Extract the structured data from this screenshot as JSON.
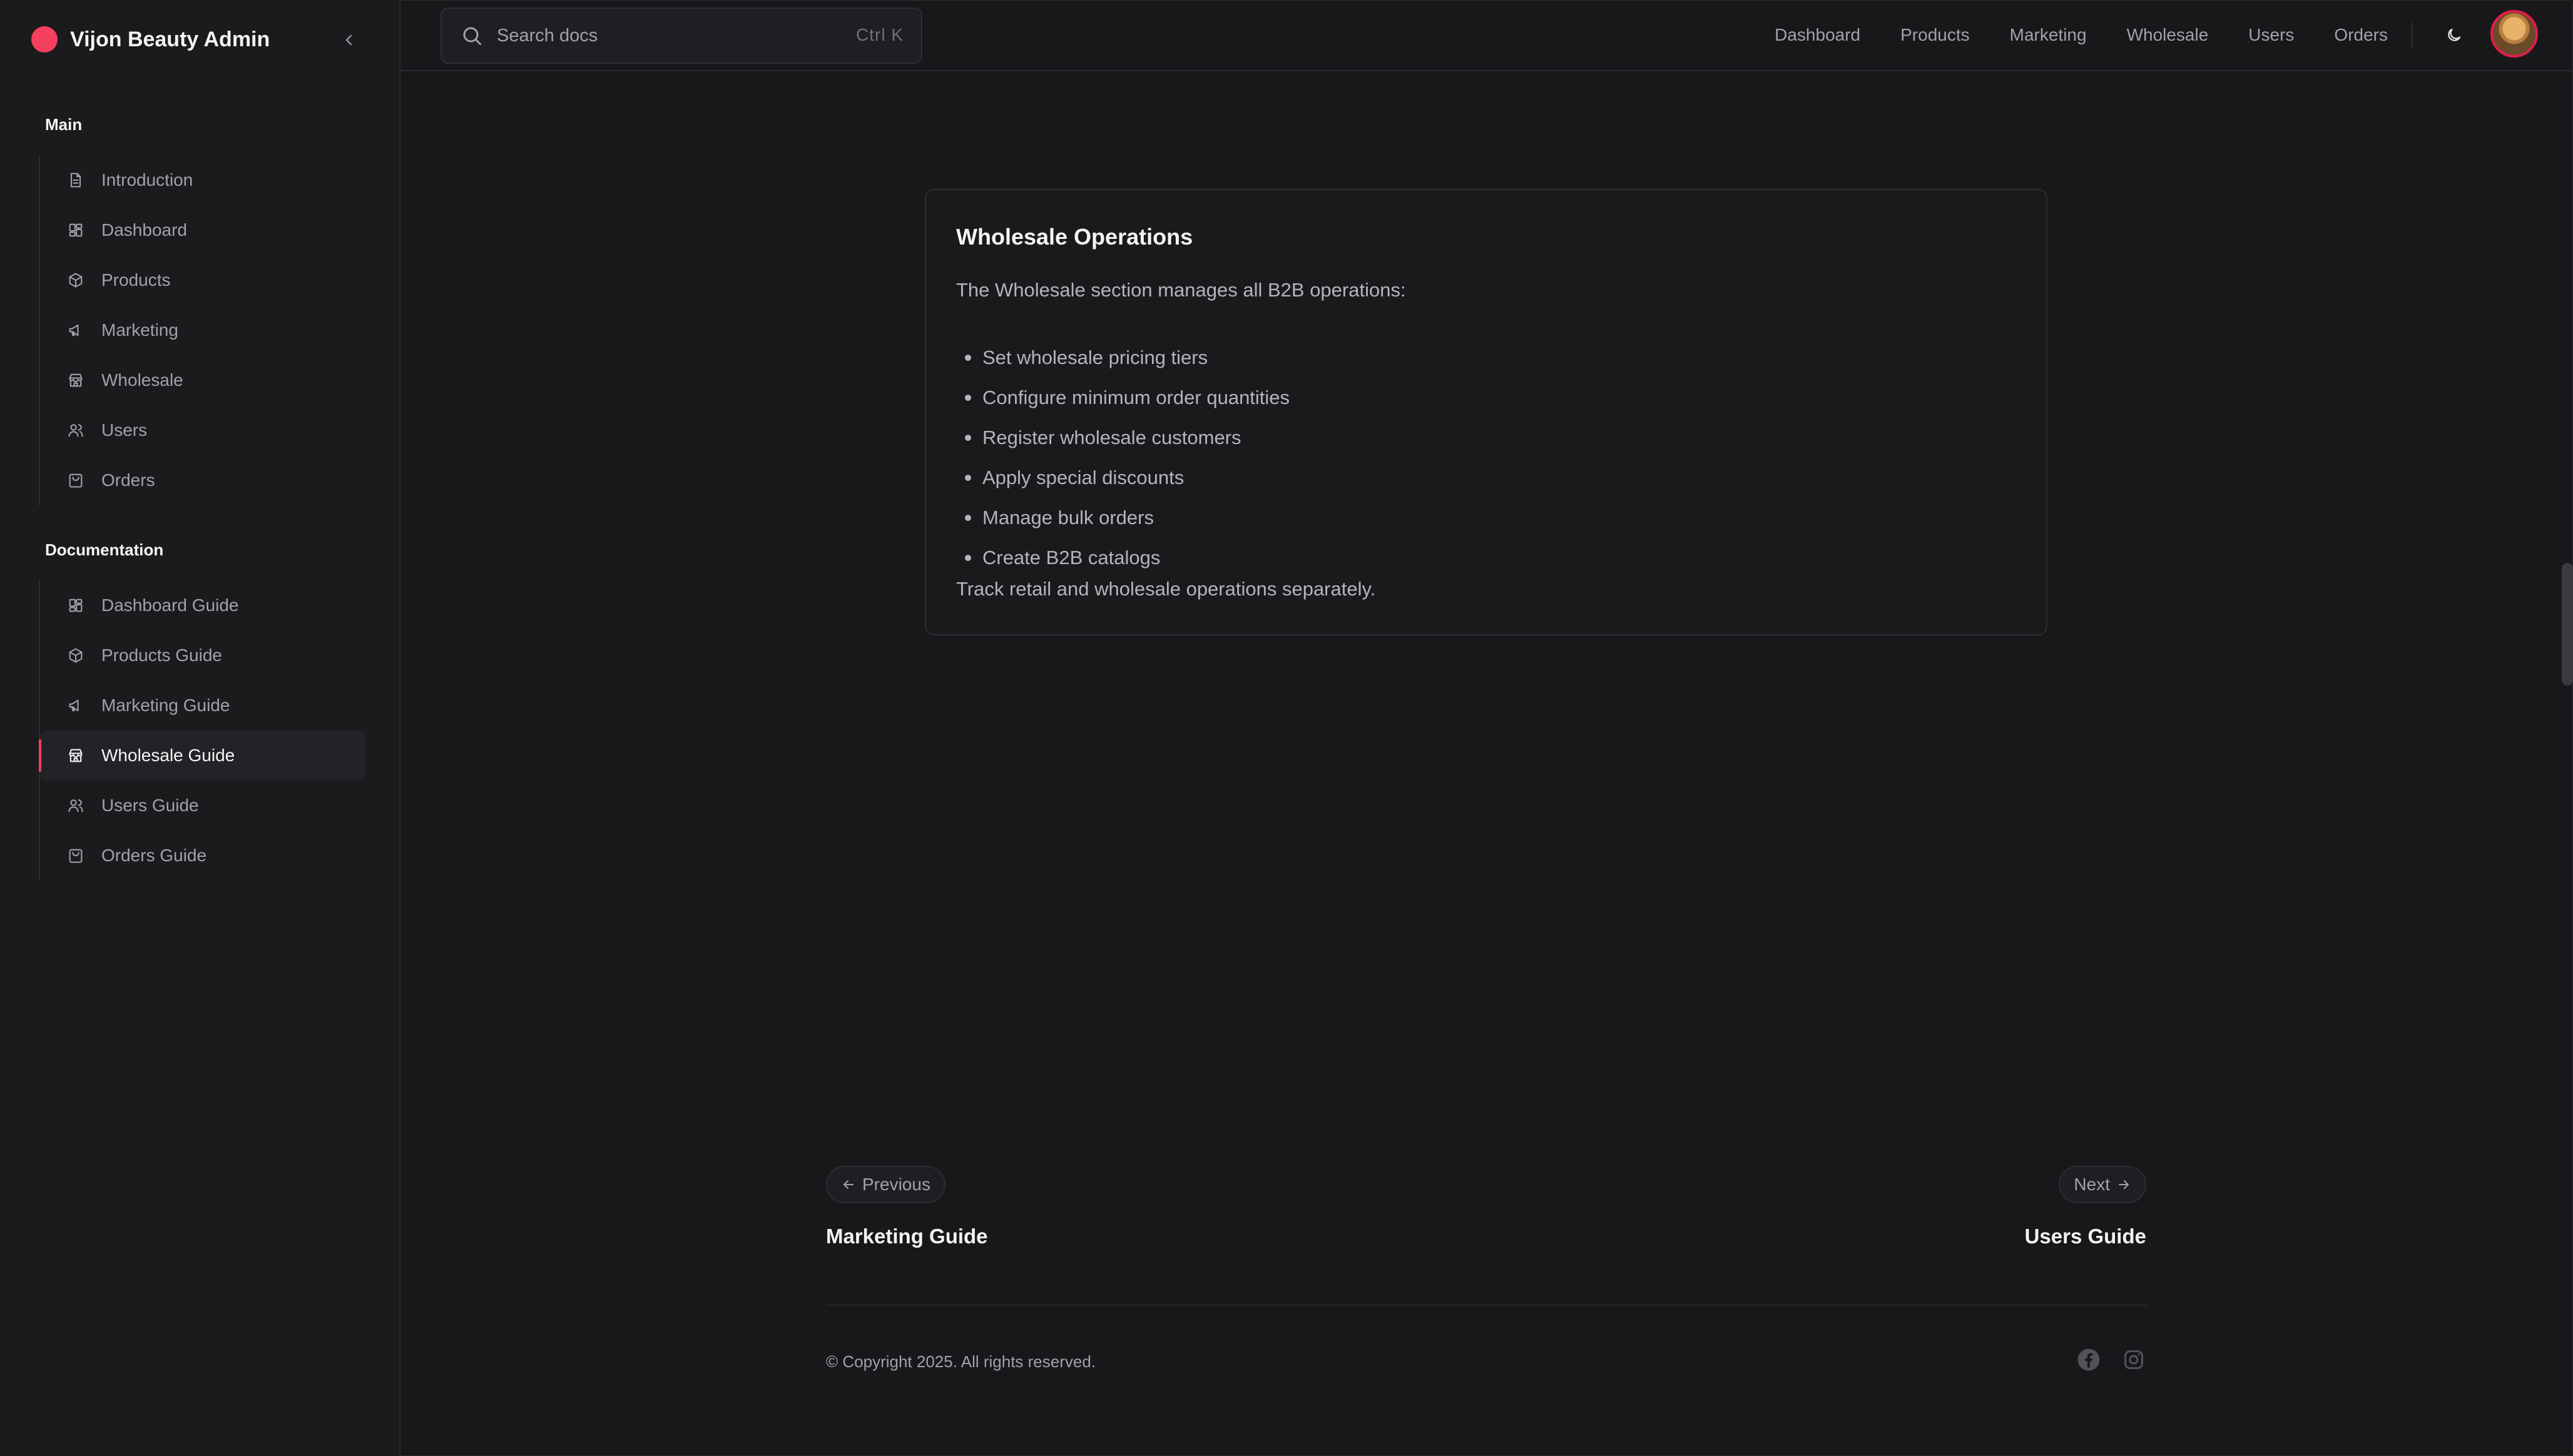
{
  "brand": {
    "title": "Vijon Beauty Admin",
    "accent": "#f43f5e"
  },
  "sidebar": {
    "main_label": "Main",
    "main_items": [
      {
        "label": "Introduction",
        "icon": "document-icon"
      },
      {
        "label": "Dashboard",
        "icon": "dashboard-icon"
      },
      {
        "label": "Products",
        "icon": "box-icon"
      },
      {
        "label": "Marketing",
        "icon": "megaphone-icon"
      },
      {
        "label": "Wholesale",
        "icon": "store-icon"
      },
      {
        "label": "Users",
        "icon": "users-icon"
      },
      {
        "label": "Orders",
        "icon": "shopping-bag-icon"
      }
    ],
    "docs_label": "Documentation",
    "docs_items": [
      {
        "label": "Dashboard Guide",
        "icon": "dashboard-icon"
      },
      {
        "label": "Products Guide",
        "icon": "box-icon"
      },
      {
        "label": "Marketing Guide",
        "icon": "megaphone-icon"
      },
      {
        "label": "Wholesale Guide",
        "icon": "store-icon",
        "active": true
      },
      {
        "label": "Users Guide",
        "icon": "users-icon"
      },
      {
        "label": "Orders Guide",
        "icon": "shopping-bag-icon"
      }
    ]
  },
  "search": {
    "placeholder": "Search docs",
    "shortcut": "Ctrl  K"
  },
  "topnav": [
    "Dashboard",
    "Products",
    "Marketing",
    "Wholesale",
    "Users",
    "Orders"
  ],
  "card": {
    "title": "Wholesale Operations",
    "intro": "The Wholesale section manages all B2B operations:",
    "bullets": [
      "Set wholesale pricing tiers",
      "Configure minimum order quantities",
      "Register wholesale customers",
      "Apply special discounts",
      "Manage bulk orders",
      "Create B2B catalogs"
    ],
    "outro": "Track retail and wholesale operations separately."
  },
  "pager": {
    "prev_label": "Previous",
    "prev_title": "Marketing Guide",
    "next_label": "Next",
    "next_title": "Users Guide"
  },
  "footer": {
    "copyright": "© Copyright 2025. All rights reserved."
  }
}
